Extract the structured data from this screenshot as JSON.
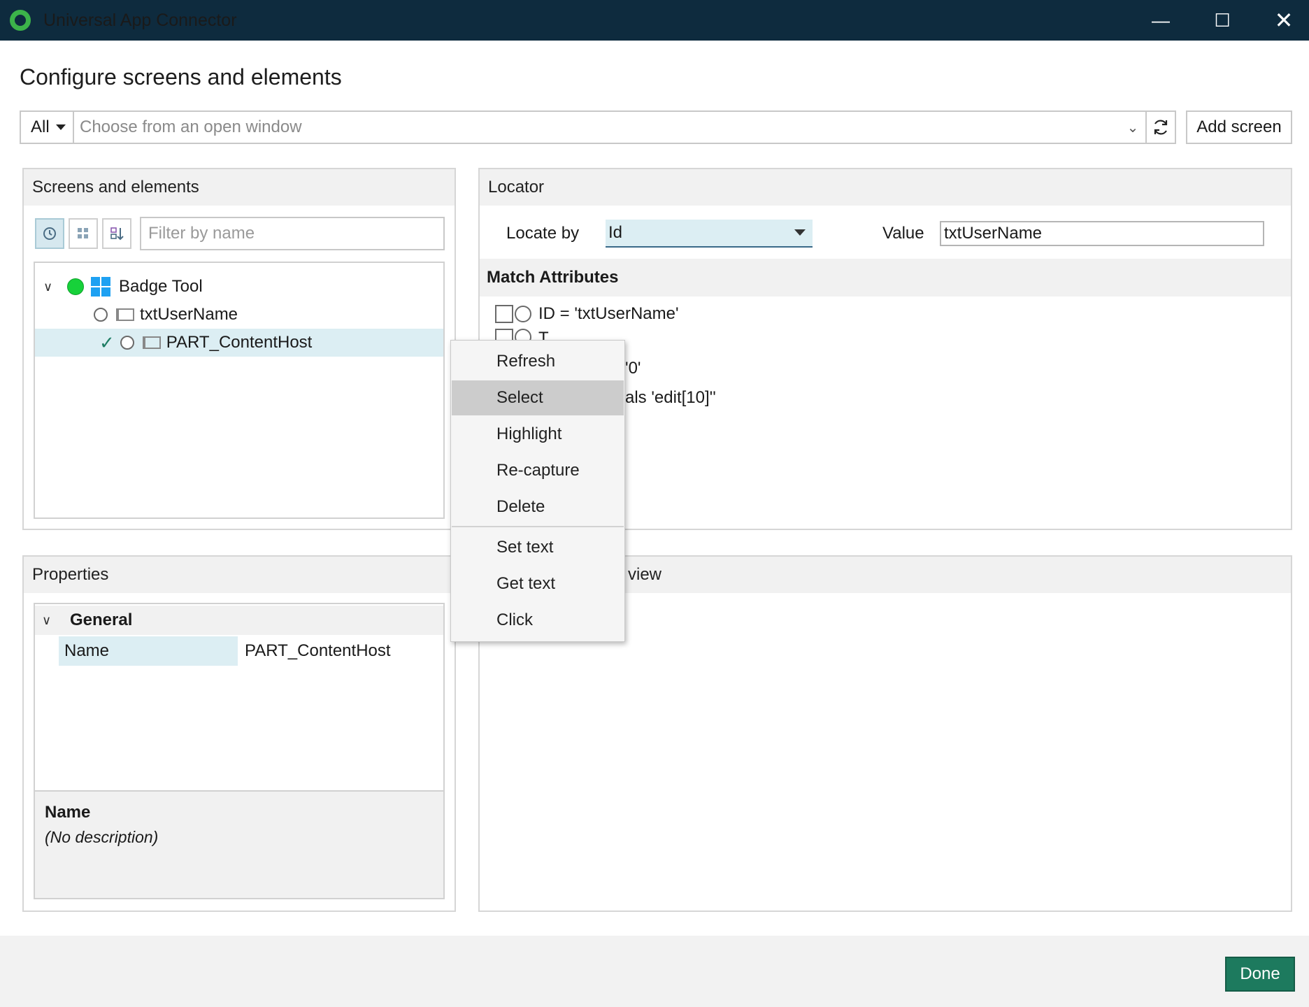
{
  "window": {
    "title": "Universal App Connector",
    "minimize_glyph": "—",
    "maximize_glyph": "☐",
    "close_glyph": "✕",
    "logo_icon": "app-ring-logo",
    "logo_color": "#3cb34a"
  },
  "page_title": "Configure screens and elements",
  "window_chooser": {
    "scope_value": "All",
    "placeholder": "Choose from an open window",
    "add_screen_label": "Add screen"
  },
  "screens_panel": {
    "title": "Screens and elements",
    "filter_placeholder": "Filter by name",
    "tree": [
      {
        "label": "Badge Tool",
        "icon": "windows-icon",
        "status_color": "#17d13a",
        "expanded": true
      },
      {
        "label": "txtUserName",
        "icon": "element-icon"
      },
      {
        "label": "PART_ContentHost",
        "icon": "element-icon",
        "selected": true,
        "checked": true
      }
    ]
  },
  "properties_panel": {
    "title": "Properties",
    "category": "General",
    "rows": [
      {
        "label": "Name",
        "value": "PART_ContentHost"
      }
    ],
    "description_title": "Name",
    "description_text": "(No description)"
  },
  "locator_panel": {
    "title": "Locator",
    "locate_by_label": "Locate by",
    "locate_by_value": "Id",
    "value_label": "Value",
    "value_text": "txtUserName",
    "match_attributes_title": "Match Attributes",
    "attributes": [
      "ID = 'txtUserName'",
      "T",
      "'0'",
      "als 'edit[10]''"
    ]
  },
  "preview_panel": {
    "title_visible": "view"
  },
  "context_menu": {
    "items": [
      "Refresh",
      "Select",
      "Highlight",
      "Re-capture",
      "Delete",
      "Set text",
      "Get text",
      "Click"
    ],
    "active_item": "Select"
  },
  "footer": {
    "done_label": "Done",
    "accent_color": "#1d7a5e"
  }
}
